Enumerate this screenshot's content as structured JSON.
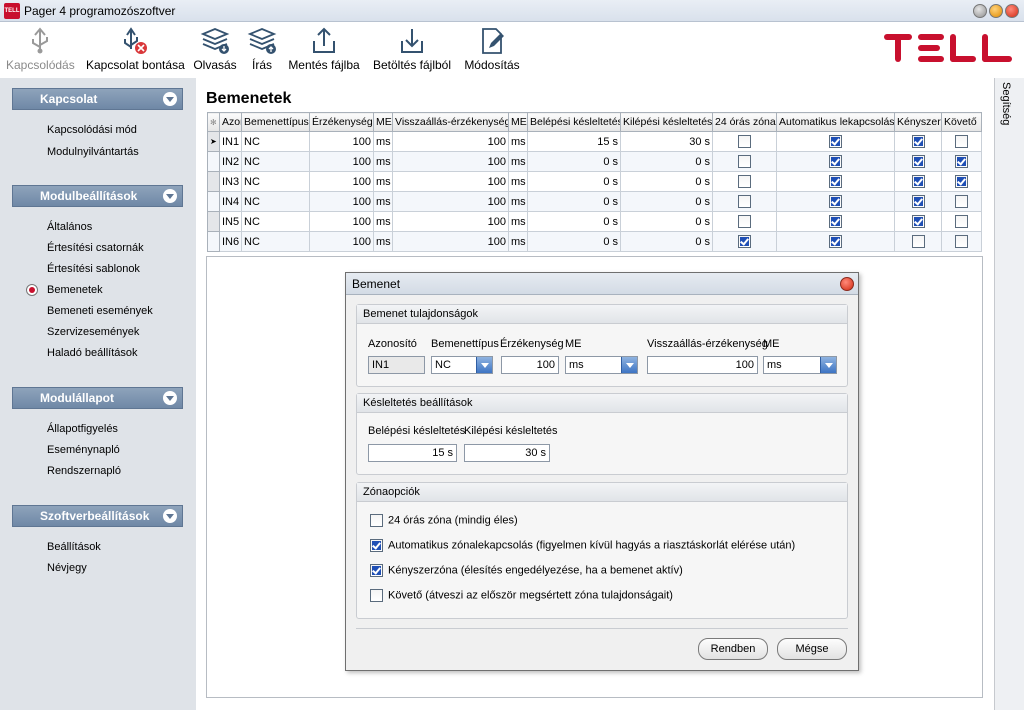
{
  "window": {
    "title": "Pager 4 programozószoftver",
    "app_icon_text": "TELL"
  },
  "toolbar": {
    "connect": "Kapcsolódás",
    "disconnect": "Kapcsolat bontása",
    "read": "Olvasás",
    "write": "Írás",
    "save_file": "Mentés fájlba",
    "load_file": "Betöltés fájlból",
    "modify": "Módosítás"
  },
  "brand": {
    "logo_text": "TELL",
    "color": "#c8102e"
  },
  "sidebar": {
    "sections": [
      {
        "title": "Kapcsolat",
        "items": [
          "Kapcsolódási mód",
          "Modulnyilvántartás"
        ]
      },
      {
        "title": "Modulbeállítások",
        "items": [
          "Általános",
          "Értesítési csatornák",
          "Értesítési sablonok",
          "Bemenetek",
          "Bemeneti események",
          "Szervizesemények",
          "Haladó beállítások"
        ]
      },
      {
        "title": "Modulállapot",
        "items": [
          "Állapotfigyelés",
          "Eseménynapló",
          "Rendszernapló"
        ]
      },
      {
        "title": "Szoftverbeállítások",
        "items": [
          "Beállítások",
          "Névjegy"
        ]
      }
    ],
    "active_item": "Bemenetek"
  },
  "help_tab": "Segítség",
  "page": {
    "title": "Bemenetek"
  },
  "grid": {
    "columns": [
      "Azon",
      "Bemenettípus",
      "Érzékenység",
      "ME",
      "Visszaállás-érzékenység",
      "ME",
      "Belépési késleltetés",
      "Kilépési késleltetés",
      "24 órás zóna",
      "Automatikus lekapcsolás",
      "Kényszer",
      "Követő"
    ],
    "rows": [
      {
        "id": "IN1",
        "type": "NC",
        "sens": "100",
        "sens_unit": "ms",
        "restore": "100",
        "restore_unit": "ms",
        "entry": "15 s",
        "exit": "30 s",
        "z24": false,
        "auto": true,
        "force": true,
        "follow": false
      },
      {
        "id": "IN2",
        "type": "NC",
        "sens": "100",
        "sens_unit": "ms",
        "restore": "100",
        "restore_unit": "ms",
        "entry": "0 s",
        "exit": "0 s",
        "z24": false,
        "auto": true,
        "force": true,
        "follow": true
      },
      {
        "id": "IN3",
        "type": "NC",
        "sens": "100",
        "sens_unit": "ms",
        "restore": "100",
        "restore_unit": "ms",
        "entry": "0 s",
        "exit": "0 s",
        "z24": false,
        "auto": true,
        "force": true,
        "follow": true
      },
      {
        "id": "IN4",
        "type": "NC",
        "sens": "100",
        "sens_unit": "ms",
        "restore": "100",
        "restore_unit": "ms",
        "entry": "0 s",
        "exit": "0 s",
        "z24": false,
        "auto": true,
        "force": true,
        "follow": false
      },
      {
        "id": "IN5",
        "type": "NC",
        "sens": "100",
        "sens_unit": "ms",
        "restore": "100",
        "restore_unit": "ms",
        "entry": "0 s",
        "exit": "0 s",
        "z24": false,
        "auto": true,
        "force": true,
        "follow": false
      },
      {
        "id": "IN6",
        "type": "NC",
        "sens": "100",
        "sens_unit": "ms",
        "restore": "100",
        "restore_unit": "ms",
        "entry": "0 s",
        "exit": "0 s",
        "z24": true,
        "auto": true,
        "force": false,
        "follow": false
      }
    ]
  },
  "dialog": {
    "title": "Bemenet",
    "props": {
      "header": "Bemenet tulajdonságok",
      "id_label": "Azonosító",
      "id_value": "IN1",
      "type_label": "Bemenettípus",
      "type_value": "NC",
      "sens_label": "Érzékenység",
      "sens_value": "100",
      "sens_unit_label": "ME",
      "sens_unit_value": "ms",
      "restore_label": "Visszaállás-érzékenység",
      "restore_value": "100",
      "restore_unit_label": "ME",
      "restore_unit_value": "ms"
    },
    "delay": {
      "header": "Késleltetés beállítások",
      "entry_label": "Belépési késleltetés",
      "entry_value": "15 s",
      "exit_label": "Kilépési késleltetés",
      "exit_value": "30 s"
    },
    "zone": {
      "header": "Zónaopciók",
      "options": [
        {
          "label": "24 órás zóna (mindig éles)",
          "checked": false
        },
        {
          "label": "Automatikus zónalekapcsolás (figyelmen kívül hagyás a riasztáskorlát elérése után)",
          "checked": true
        },
        {
          "label": "Kényszerzóna (élesítés engedélyezése, ha a bemenet aktív)",
          "checked": true
        },
        {
          "label": "Követő (átveszi az először megsértett zóna tulajdonságait)",
          "checked": false
        }
      ]
    },
    "ok": "Rendben",
    "cancel": "Mégse"
  }
}
